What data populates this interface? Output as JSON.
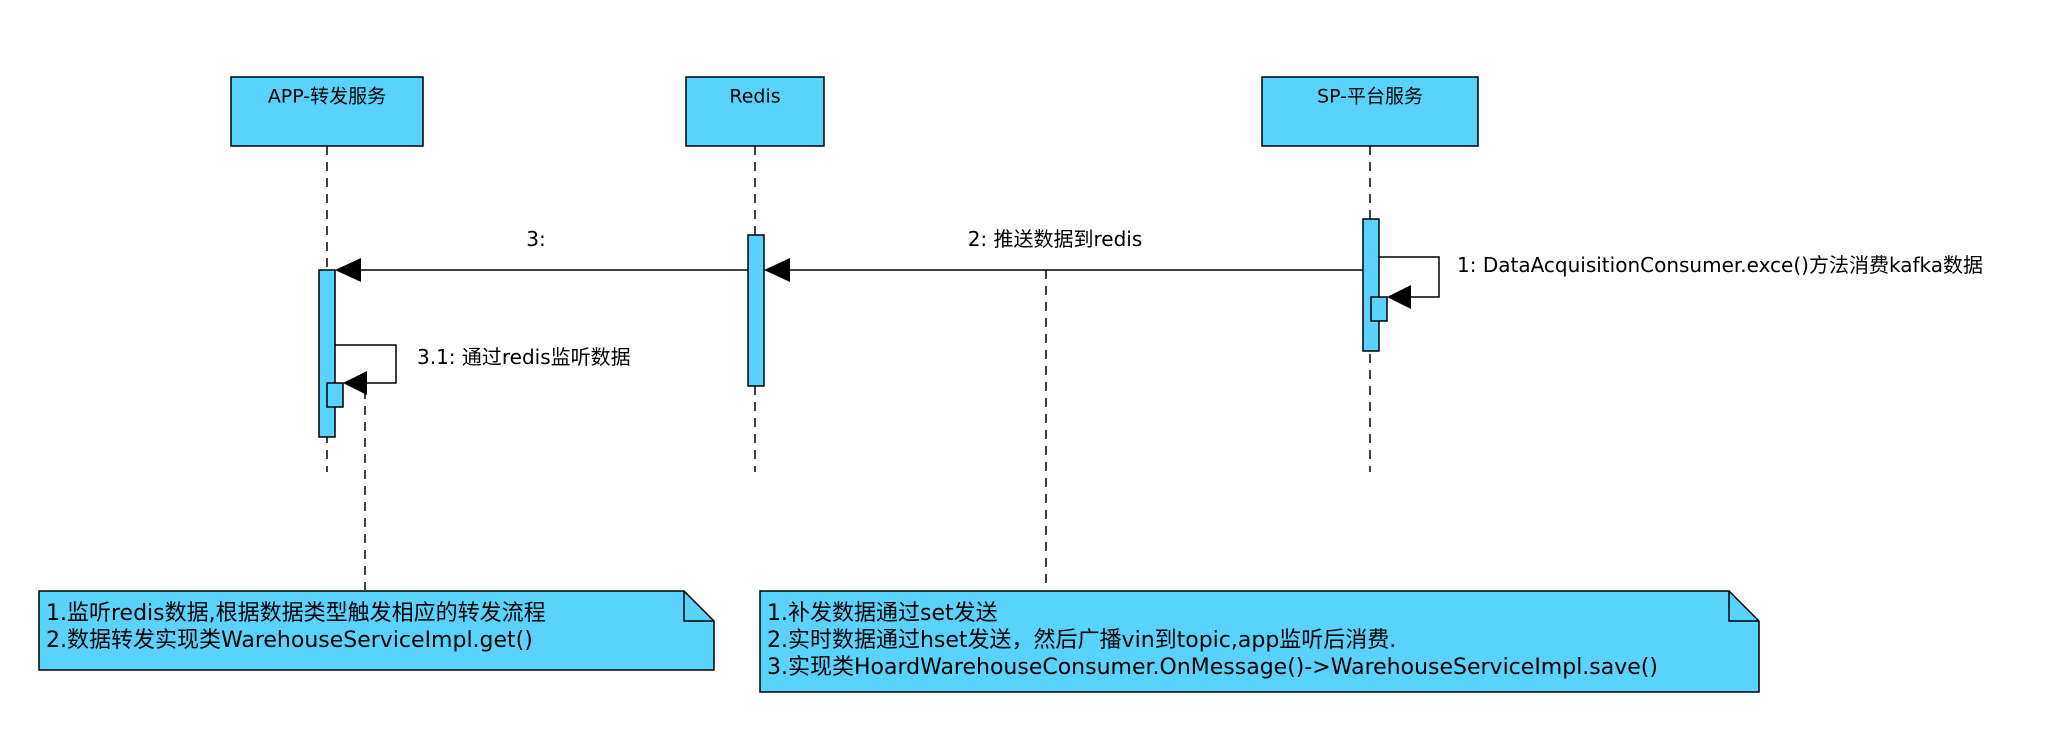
{
  "colors": {
    "fill": "#59d2fc",
    "stroke": "#000000",
    "background": "#ffffff"
  },
  "lifelines": [
    {
      "id": "app",
      "title": "APP-转发服务"
    },
    {
      "id": "redis",
      "title": "Redis"
    },
    {
      "id": "sp",
      "title": "SP-平台服务"
    }
  ],
  "messages": [
    {
      "id": "m1",
      "label": "1: DataAcquisitionConsumer.exce()方法消费kafka数据",
      "from": "sp",
      "to": "sp",
      "kind": "self"
    },
    {
      "id": "m2",
      "label": "2: 推送数据到redis",
      "from": "sp",
      "to": "redis",
      "kind": "sync"
    },
    {
      "id": "m3",
      "label": "3:",
      "from": "redis",
      "to": "app",
      "kind": "sync"
    },
    {
      "id": "m31",
      "label": "3.1: 通过redis监听数据",
      "from": "app",
      "to": "app",
      "kind": "self"
    }
  ],
  "notes": [
    {
      "id": "note-app",
      "lines": [
        "1.监听redis数据,根据数据类型触发相应的转发流程",
        "2.数据转发实现类WarehouseServiceImpl.get()"
      ]
    },
    {
      "id": "note-redis",
      "lines": [
        "1.补发数据通过set发送",
        "2.实时数据通过hset发送，然后广播vin到topic,app监听后消费.",
        "3.实现类HoardWarehouseConsumer.OnMessage()->WarehouseServiceImpl.save()"
      ]
    }
  ]
}
